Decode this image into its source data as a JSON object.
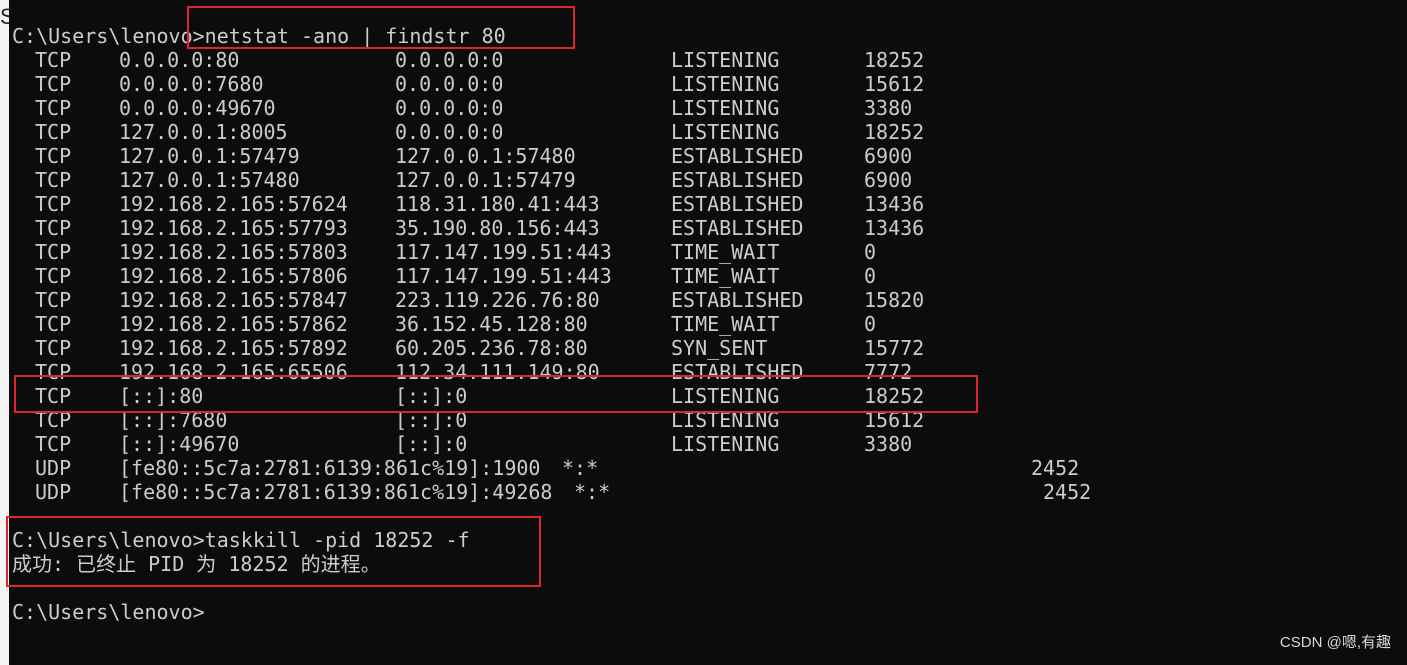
{
  "header_cut": "S",
  "command1": {
    "prompt": "C:\\Users\\lenovo>",
    "command": "netstat -ano | findstr 80"
  },
  "tcp_rows": [
    {
      "proto": "TCP",
      "local": "0.0.0.0:80",
      "foreign": "0.0.0.0:0",
      "state": "LISTENING",
      "pid": "18252"
    },
    {
      "proto": "TCP",
      "local": "0.0.0.0:7680",
      "foreign": "0.0.0.0:0",
      "state": "LISTENING",
      "pid": "15612"
    },
    {
      "proto": "TCP",
      "local": "0.0.0.0:49670",
      "foreign": "0.0.0.0:0",
      "state": "LISTENING",
      "pid": "3380"
    },
    {
      "proto": "TCP",
      "local": "127.0.0.1:8005",
      "foreign": "0.0.0.0:0",
      "state": "LISTENING",
      "pid": "18252"
    },
    {
      "proto": "TCP",
      "local": "127.0.0.1:57479",
      "foreign": "127.0.0.1:57480",
      "state": "ESTABLISHED",
      "pid": "6900"
    },
    {
      "proto": "TCP",
      "local": "127.0.0.1:57480",
      "foreign": "127.0.0.1:57479",
      "state": "ESTABLISHED",
      "pid": "6900"
    },
    {
      "proto": "TCP",
      "local": "192.168.2.165:57624",
      "foreign": "118.31.180.41:443",
      "state": "ESTABLISHED",
      "pid": "13436"
    },
    {
      "proto": "TCP",
      "local": "192.168.2.165:57793",
      "foreign": "35.190.80.156:443",
      "state": "ESTABLISHED",
      "pid": "13436"
    },
    {
      "proto": "TCP",
      "local": "192.168.2.165:57803",
      "foreign": "117.147.199.51:443",
      "state": "TIME_WAIT",
      "pid": "0"
    },
    {
      "proto": "TCP",
      "local": "192.168.2.165:57806",
      "foreign": "117.147.199.51:443",
      "state": "TIME_WAIT",
      "pid": "0"
    },
    {
      "proto": "TCP",
      "local": "192.168.2.165:57847",
      "foreign": "223.119.226.76:80",
      "state": "ESTABLISHED",
      "pid": "15820"
    },
    {
      "proto": "TCP",
      "local": "192.168.2.165:57862",
      "foreign": "36.152.45.128:80",
      "state": "TIME_WAIT",
      "pid": "0"
    },
    {
      "proto": "TCP",
      "local": "192.168.2.165:57892",
      "foreign": "60.205.236.78:80",
      "state": "SYN_SENT",
      "pid": "15772"
    },
    {
      "proto": "TCP",
      "local": "192.168.2.165:65506",
      "foreign": "112.34.111.149:80",
      "state": "ESTABLISHED",
      "pid": "7772"
    },
    {
      "proto": "TCP",
      "local": "[::]:80",
      "foreign": "[::]:0",
      "state": "LISTENING",
      "pid": "18252"
    },
    {
      "proto": "TCP",
      "local": "[::]:7680",
      "foreign": "[::]:0",
      "state": "LISTENING",
      "pid": "15612"
    },
    {
      "proto": "TCP",
      "local": "[::]:49670",
      "foreign": "[::]:0",
      "state": "LISTENING",
      "pid": "3380"
    }
  ],
  "udp_rows": [
    {
      "proto": "UDP",
      "local": "[fe80::5c7a:2781:6139:861c%19]:1900",
      "foreign": "*:*",
      "pid": "2452"
    },
    {
      "proto": "UDP",
      "local": "[fe80::5c7a:2781:6139:861c%19]:49268",
      "foreign": "*:*",
      "pid": "2452"
    }
  ],
  "command2": {
    "prompt": "C:\\Users\\lenovo>",
    "command": "taskkill -pid 18252 -f",
    "result": "成功: 已终止 PID 为 18252 的进程。"
  },
  "final_prompt": "C:\\Users\\lenovo>",
  "watermark": "CSDN @嗯,有趣",
  "colors": {
    "background": "#0c0c0c",
    "text": "#cccccc",
    "highlight_border": "#e0242b"
  }
}
